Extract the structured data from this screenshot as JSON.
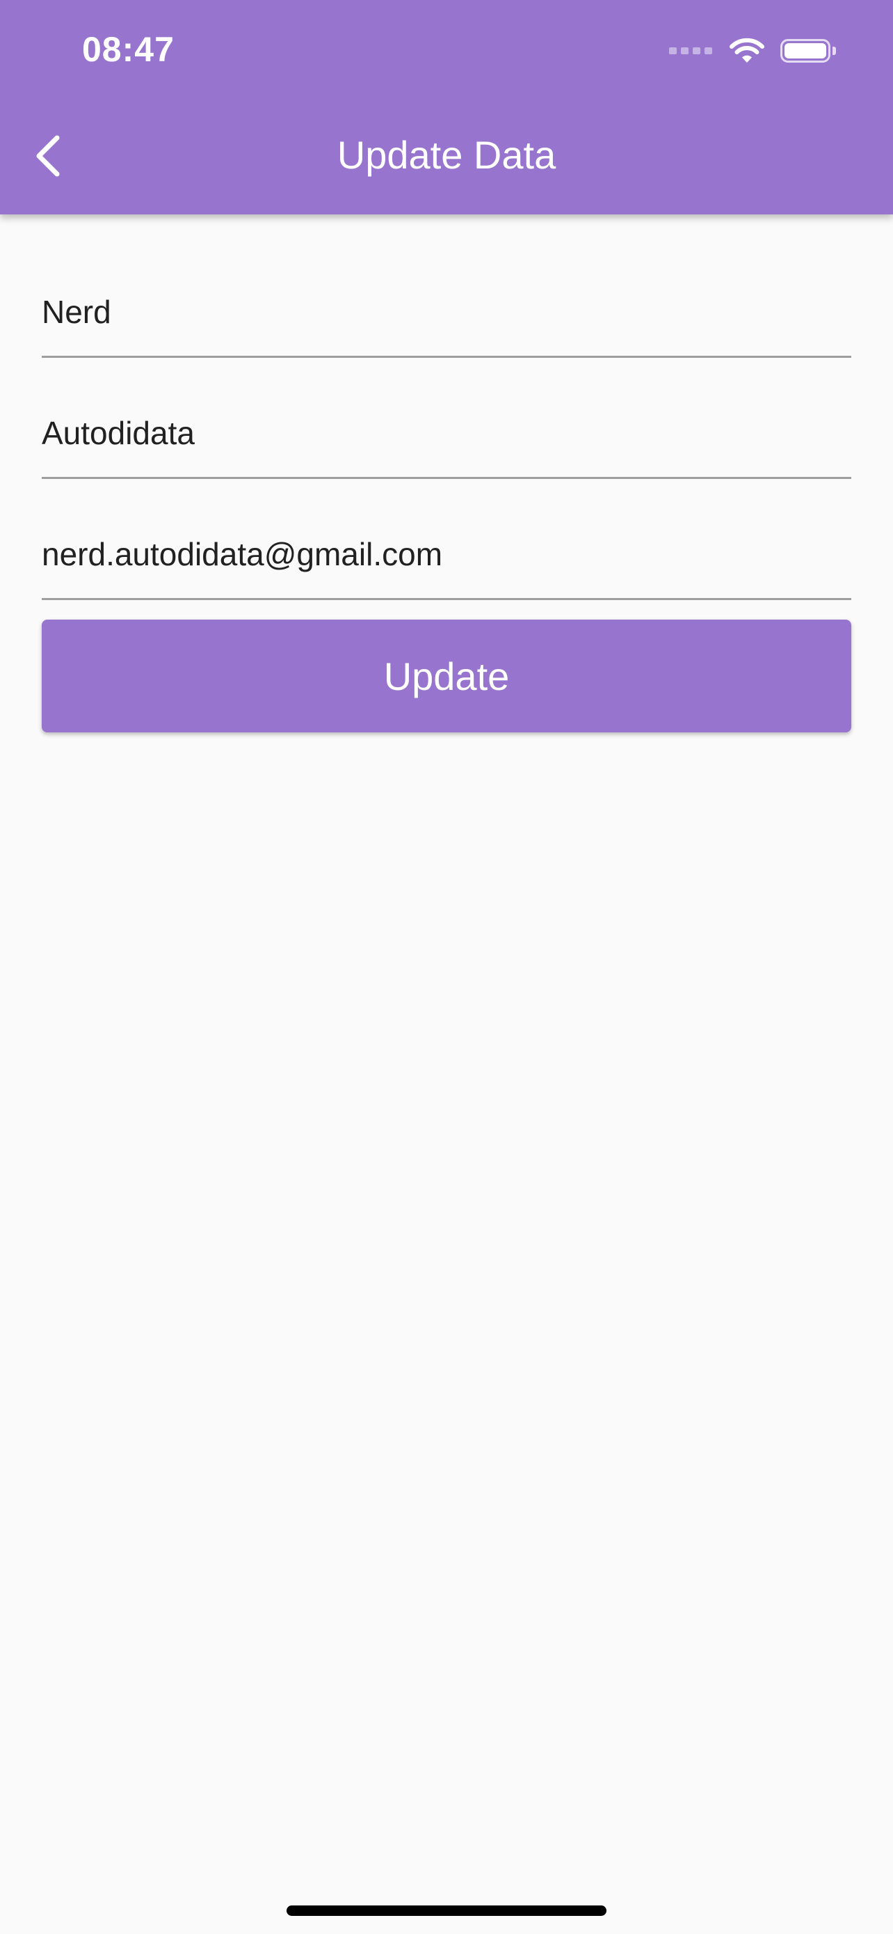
{
  "status_bar": {
    "time": "08:47"
  },
  "app_bar": {
    "title": "Update Data",
    "back_icon": "chevron-left-icon",
    "background_color": "#9775cf"
  },
  "form": {
    "first_name": {
      "value": "Nerd"
    },
    "last_name": {
      "value": "Autodidata"
    },
    "email": {
      "value": "nerd.autodidata@gmail.com"
    },
    "submit_label": "Update"
  },
  "colors": {
    "accent": "#9775cf",
    "background": "#fafafa",
    "underline": "#9e9e9e",
    "text": "#212121"
  }
}
